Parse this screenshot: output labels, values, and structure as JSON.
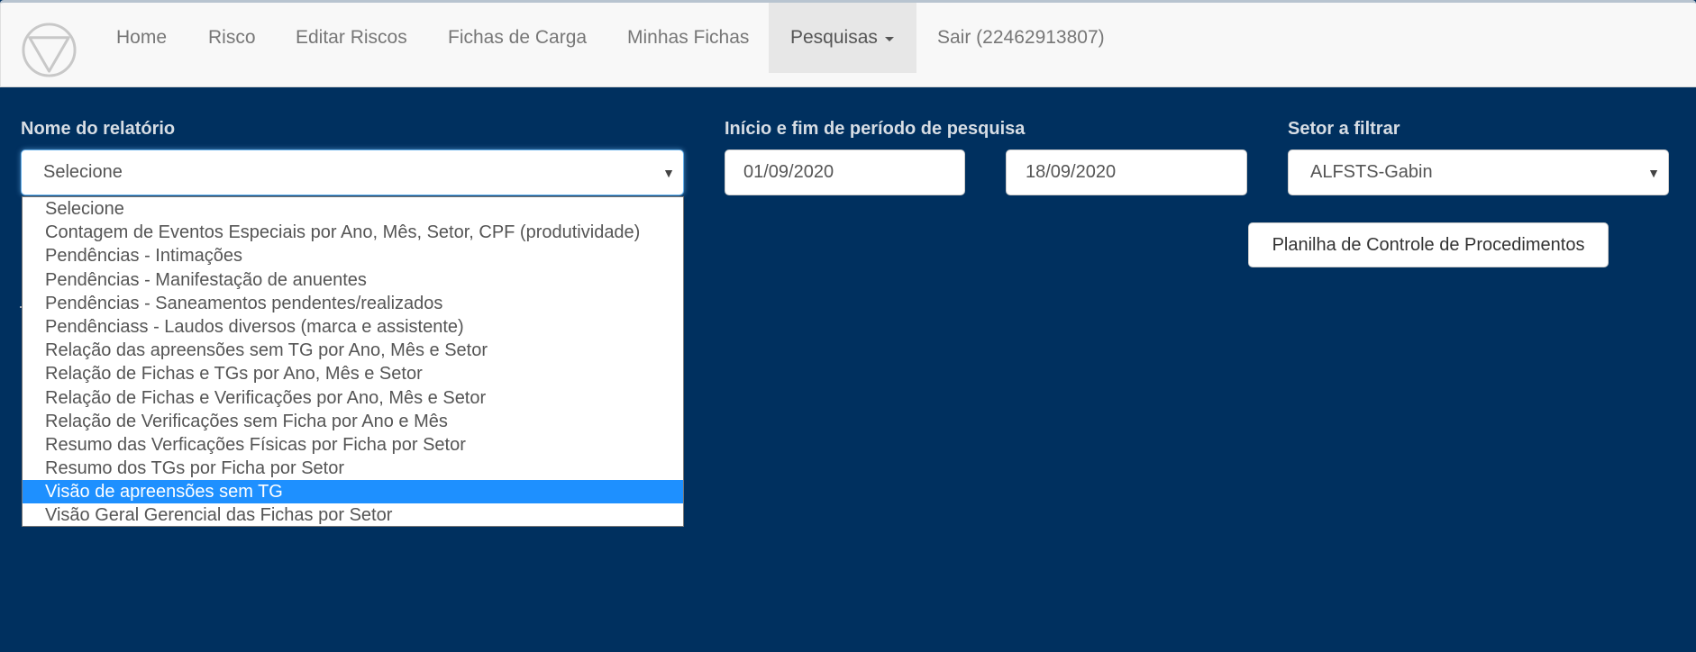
{
  "nav": {
    "logo_icon": "inverted-triangle-circle-icon",
    "items": [
      {
        "label": "Home"
      },
      {
        "label": "Risco"
      },
      {
        "label": "Editar Riscos"
      },
      {
        "label": "Fichas de Carga"
      },
      {
        "label": "Minhas Fichas"
      },
      {
        "label": "Pesquisas",
        "active": true,
        "dropdown": true
      },
      {
        "label": "Sair (22462913807)"
      }
    ]
  },
  "form": {
    "report": {
      "label": "Nome do relatório",
      "value": "Selecione",
      "options": [
        "Selecione",
        "Contagem de Eventos Especiais por Ano, Mês, Setor, CPF (produtividade)",
        "Pendências - Intimações",
        "Pendências - Manifestação de anuentes",
        "Pendências - Saneamentos pendentes/realizados",
        "Pendênciass - Laudos diversos (marca e assistente)",
        "Relação das apreensões sem TG por Ano, Mês e Setor",
        "Relação de Fichas e TGs por Ano, Mês e Setor",
        "Relação de Fichas e Verificações por Ano, Mês e Setor",
        "Relação de Verificações sem Ficha por Ano e Mês",
        "Resumo das Verficações Físicas por Ficha por Setor",
        "Resumo dos TGs por Ficha por Setor",
        "Visão de apreensões sem TG",
        "Visão Geral Gerencial das Fichas por Setor"
      ],
      "highlighted_index": 12
    },
    "period": {
      "label": "Início e fim de período de pesquisa",
      "start": "01/09/2020",
      "end": "18/09/2020"
    },
    "sector": {
      "label": "Setor a filtrar",
      "value": "ALFSTS-Gabin"
    },
    "action_button": "Planilha de Controle de Procedimentos"
  },
  "colors": {
    "background": "#00305f",
    "navbar": "#f8f8f8",
    "highlight": "#1e90ff"
  }
}
